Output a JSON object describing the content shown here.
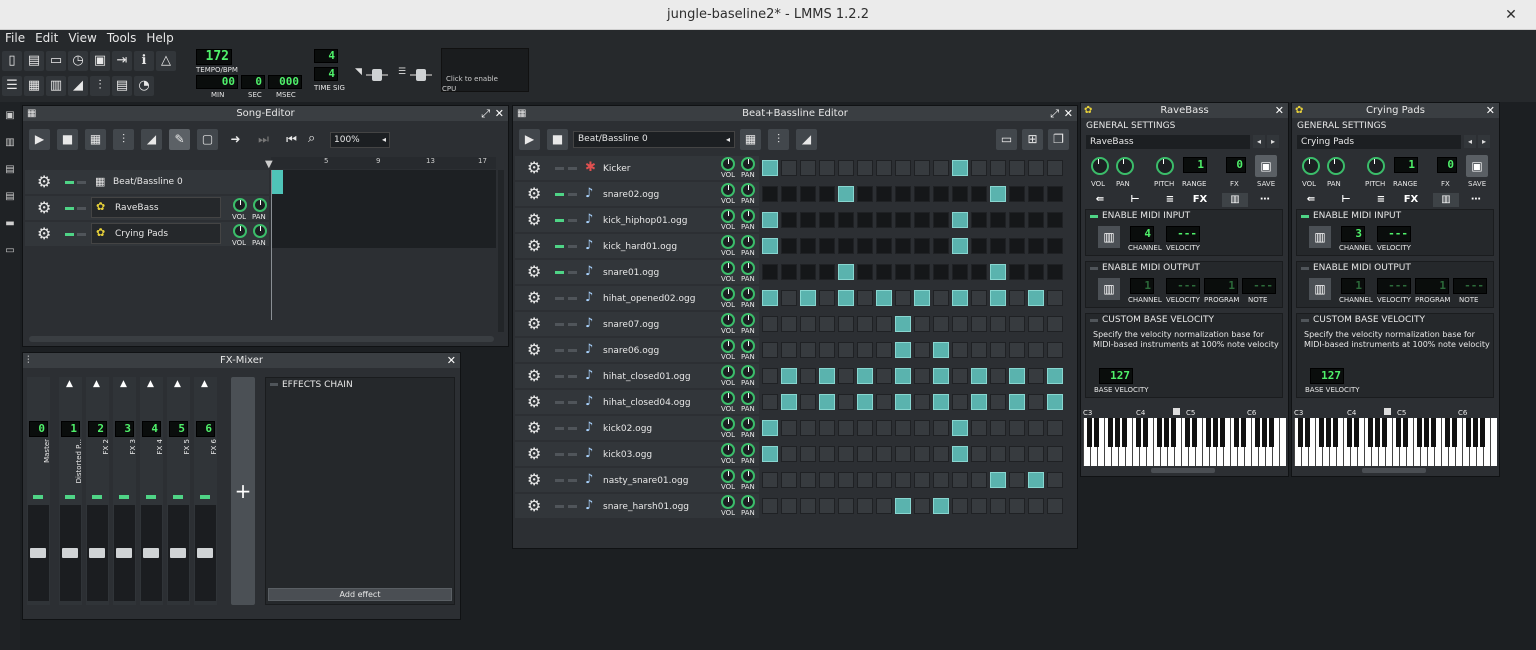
{
  "window": {
    "title": "jungle-baseline2* - LMMS 1.2.2"
  },
  "menu": [
    "File",
    "Edit",
    "View",
    "Tools",
    "Help"
  ],
  "transport": {
    "tempo": "172",
    "tempo_label": "TEMPO/BPM",
    "min": "00",
    "min_label": "MIN",
    "sec": "0",
    "sec_label": "SEC",
    "msec": "000",
    "msec_label": "MSEC",
    "timesig_num": "4",
    "timesig_den": "4",
    "timesig_label": "TIME SIG",
    "cpu_hint": "Click to enable",
    "cpu_label": "CPU"
  },
  "song_editor": {
    "title": "Song-Editor",
    "zoom": "100%",
    "ruler": [
      "5",
      "9",
      "13",
      "17"
    ],
    "tracks": [
      {
        "name": "Beat/Bassline 0",
        "icon": "beat-icon"
      },
      {
        "name": "RaveBass",
        "icon": "tripleoscillator-icon"
      },
      {
        "name": "Crying Pads",
        "icon": "tripleoscillator-icon"
      }
    ],
    "vol_label": "VOL",
    "pan_label": "PAN"
  },
  "bb_editor": {
    "title": "Beat+Bassline Editor",
    "selector": "Beat/Bassline 0",
    "vol_label": "VOL",
    "pan_label": "PAN",
    "tracks": [
      {
        "name": "Kicker",
        "steps": [
          1,
          0,
          0,
          0,
          0,
          0,
          0,
          0,
          0,
          0,
          1,
          0,
          0,
          0,
          0,
          0
        ],
        "dark": false,
        "led": false
      },
      {
        "name": "snare02.ogg",
        "steps": [
          0,
          0,
          0,
          0,
          1,
          0,
          0,
          0,
          0,
          0,
          0,
          0,
          1,
          0,
          0,
          0
        ],
        "dark": true,
        "led": true
      },
      {
        "name": "kick_hiphop01.ogg",
        "steps": [
          1,
          0,
          0,
          0,
          0,
          0,
          0,
          0,
          0,
          0,
          1,
          0,
          0,
          0,
          0,
          0
        ],
        "dark": true,
        "led": true
      },
      {
        "name": "kick_hard01.ogg",
        "steps": [
          1,
          0,
          0,
          0,
          0,
          0,
          0,
          0,
          0,
          0,
          1,
          0,
          0,
          0,
          0,
          0
        ],
        "dark": true,
        "led": true
      },
      {
        "name": "snare01.ogg",
        "steps": [
          0,
          0,
          0,
          0,
          1,
          0,
          0,
          0,
          0,
          0,
          0,
          0,
          1,
          0,
          0,
          0
        ],
        "dark": true,
        "led": true
      },
      {
        "name": "hihat_opened02.ogg",
        "steps": [
          1,
          0,
          1,
          0,
          1,
          0,
          1,
          0,
          1,
          0,
          1,
          0,
          1,
          0,
          1,
          0
        ],
        "dark": false,
        "led": false
      },
      {
        "name": "snare07.ogg",
        "steps": [
          0,
          0,
          0,
          0,
          0,
          0,
          0,
          1,
          0,
          0,
          0,
          0,
          0,
          0,
          0,
          0
        ],
        "dark": false,
        "led": false
      },
      {
        "name": "snare06.ogg",
        "steps": [
          0,
          0,
          0,
          0,
          0,
          0,
          0,
          1,
          0,
          1,
          0,
          0,
          0,
          0,
          0,
          0
        ],
        "dark": false,
        "led": false
      },
      {
        "name": "hihat_closed01.ogg",
        "steps": [
          0,
          1,
          0,
          1,
          0,
          1,
          0,
          1,
          0,
          1,
          0,
          1,
          0,
          1,
          0,
          1
        ],
        "dark": false,
        "led": false
      },
      {
        "name": "hihat_closed04.ogg",
        "steps": [
          0,
          1,
          0,
          1,
          0,
          1,
          0,
          1,
          0,
          1,
          0,
          1,
          0,
          1,
          0,
          1
        ],
        "dark": false,
        "led": false
      },
      {
        "name": "kick02.ogg",
        "steps": [
          1,
          0,
          0,
          0,
          0,
          0,
          0,
          0,
          0,
          0,
          1,
          0,
          0,
          0,
          0,
          0
        ],
        "dark": false,
        "led": false
      },
      {
        "name": "kick03.ogg",
        "steps": [
          1,
          0,
          0,
          0,
          0,
          0,
          0,
          0,
          0,
          0,
          1,
          0,
          0,
          0,
          0,
          0
        ],
        "dark": false,
        "led": false
      },
      {
        "name": "nasty_snare01.ogg",
        "steps": [
          0,
          0,
          0,
          0,
          0,
          0,
          0,
          0,
          0,
          0,
          0,
          0,
          1,
          0,
          1,
          0
        ],
        "dark": false,
        "led": false
      },
      {
        "name": "snare_harsh01.ogg",
        "steps": [
          0,
          0,
          0,
          0,
          0,
          0,
          0,
          1,
          0,
          1,
          0,
          0,
          0,
          0,
          0,
          0
        ],
        "dark": false,
        "led": false
      }
    ]
  },
  "fx_mixer": {
    "title": "FX-Mixer",
    "channels": [
      {
        "num": "0",
        "name": "Master"
      },
      {
        "num": "1",
        "name": "Distorted P..."
      },
      {
        "num": "2",
        "name": "FX 2"
      },
      {
        "num": "3",
        "name": "FX 3"
      },
      {
        "num": "4",
        "name": "FX 4"
      },
      {
        "num": "5",
        "name": "FX 5"
      },
      {
        "num": "6",
        "name": "FX 6"
      }
    ],
    "effects_chain": "EFFECTS CHAIN",
    "add_effect": "Add effect",
    "add_channel": "+"
  },
  "instruments": [
    {
      "title": "RaveBass",
      "name": "RaveBass",
      "general": "GENERAL SETTINGS",
      "labels": {
        "vol": "VOL",
        "pan": "PAN",
        "pitch": "PITCH",
        "range": "RANGE",
        "fx": "FX",
        "save": "SAVE"
      },
      "range": "1",
      "fx": "0",
      "tab_fx": "FX",
      "midi_in": "ENABLE MIDI INPUT",
      "midi_in_channel": "4",
      "midi_in_velocity": "---",
      "midi_out": "ENABLE MIDI OUTPUT",
      "midi_out_channel": "1",
      "midi_out_velocity": "---",
      "midi_out_program": "1",
      "midi_out_note": "---",
      "channel_label": "CHANNEL",
      "velocity_label": "VELOCITY",
      "program_label": "PROGRAM",
      "note_label": "NOTE",
      "custom_vel": "CUSTOM BASE VELOCITY",
      "custom_desc": "Specify the velocity normalization base for MIDI-based instruments at 100% note velocity",
      "base_vel": "127",
      "base_vel_label": "BASE VELOCITY",
      "keys": [
        "C3",
        "C4",
        "C5",
        "C6"
      ]
    },
    {
      "title": "Crying Pads",
      "name": "Crying Pads",
      "general": "GENERAL SETTINGS",
      "labels": {
        "vol": "VOL",
        "pan": "PAN",
        "pitch": "PITCH",
        "range": "RANGE",
        "fx": "FX",
        "save": "SAVE"
      },
      "range": "1",
      "fx": "0",
      "tab_fx": "FX",
      "midi_in": "ENABLE MIDI INPUT",
      "midi_in_channel": "3",
      "midi_in_velocity": "---",
      "midi_out": "ENABLE MIDI OUTPUT",
      "midi_out_channel": "1",
      "midi_out_velocity": "---",
      "midi_out_program": "1",
      "midi_out_note": "---",
      "channel_label": "CHANNEL",
      "velocity_label": "VELOCITY",
      "program_label": "PROGRAM",
      "note_label": "NOTE",
      "custom_vel": "CUSTOM BASE VELOCITY",
      "custom_desc": "Specify the velocity normalization base for MIDI-based instruments at 100% note velocity",
      "base_vel": "127",
      "base_vel_label": "BASE VELOCITY",
      "keys": [
        "C3",
        "C4",
        "C5",
        "C6"
      ]
    }
  ]
}
